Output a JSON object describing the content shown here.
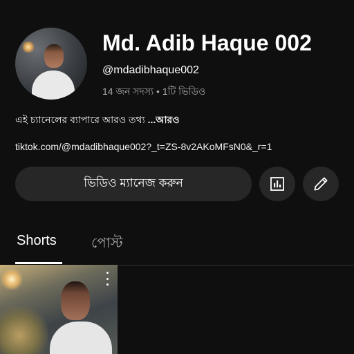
{
  "channel": {
    "name": "Md. Adib Haque 002",
    "handle": "@mdadibhaque002",
    "meta": "14 জন সদস্য • 1টি ভিডিও",
    "description": "এই চ্যানেলের ব্যাপারে আরও তথ্য ",
    "more_label": "...আরও",
    "link": "tiktok.com/@mdadibhaque002?_t=ZS-8v2AKoMFsN0&_r=1"
  },
  "actions": {
    "manage_label": "ভিডিও ম্যানেজ করুন",
    "stats_icon": "analytics-icon",
    "edit_icon": "pencil-icon"
  },
  "tabs": [
    {
      "label": "Shorts",
      "selected": true
    },
    {
      "label": "পোস্ট",
      "selected": false
    }
  ],
  "colors": {
    "background": "#0f0f0f",
    "button": "#272727",
    "secondary_text": "#aaaaaa"
  }
}
